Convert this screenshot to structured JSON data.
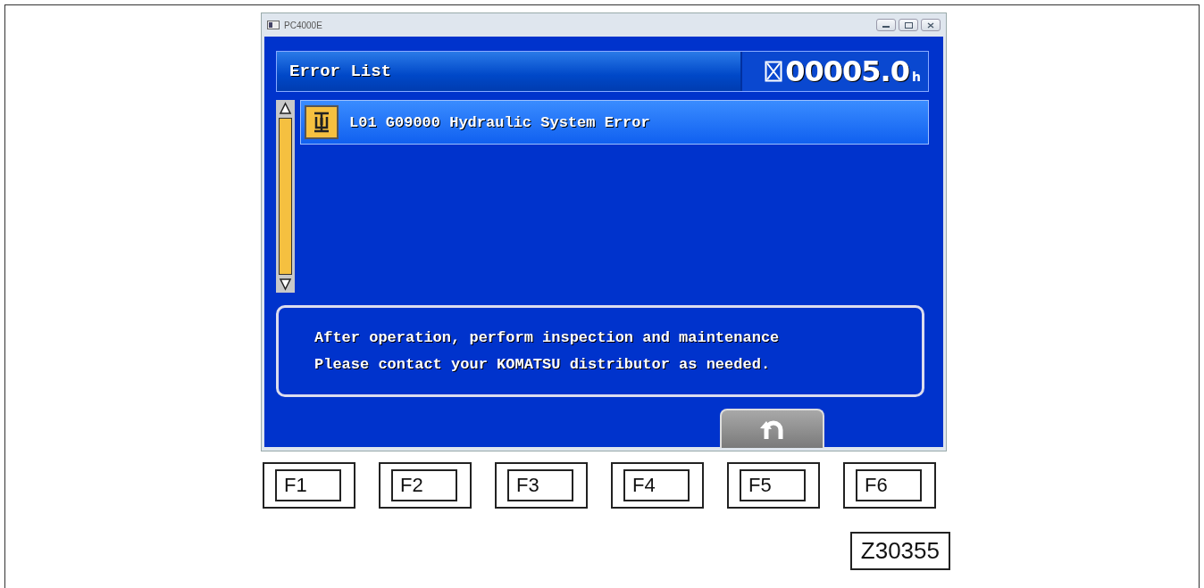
{
  "window": {
    "title": "PC4000E"
  },
  "header": {
    "title": "Error List",
    "hour_meter": "00005.0",
    "hour_unit": "h"
  },
  "errors": [
    {
      "text": "L01 G09000 Hydraulic System Error",
      "selected": true
    }
  ],
  "message": {
    "lines": [
      "After operation, perform inspection and maintenance",
      "Please contact your KOMATSU distributor as needed."
    ]
  },
  "function_keys": [
    "F1",
    "F2",
    "F3",
    "F4",
    "F5",
    "F6"
  ],
  "figure_id": "Z30355"
}
